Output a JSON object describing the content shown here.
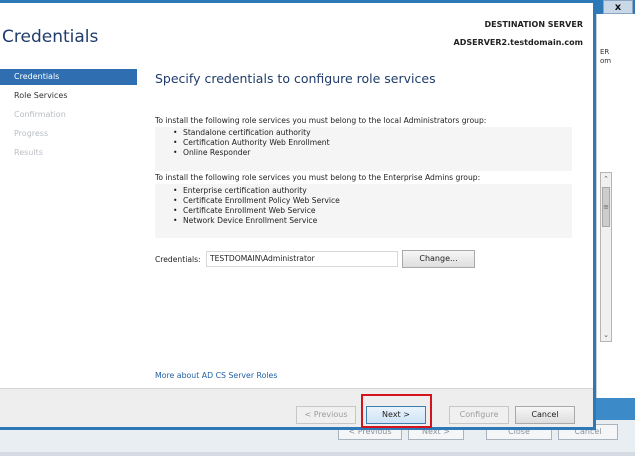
{
  "background": {
    "right_panel_text": "ER\nom",
    "close_glyph": "x",
    "ghost_buttons": [
      "< Previous",
      "Next >",
      "Close",
      "Cancel"
    ]
  },
  "wizard": {
    "title": "Credentials",
    "destination_label": "DESTINATION SERVER",
    "destination_server": "ADSERVER2.testdomain.com"
  },
  "nav": {
    "items": [
      {
        "label": "Credentials",
        "state": "active"
      },
      {
        "label": "Role Services",
        "state": "enabled"
      },
      {
        "label": "Confirmation",
        "state": "disabled"
      },
      {
        "label": "Progress",
        "state": "disabled"
      },
      {
        "label": "Results",
        "state": "disabled"
      }
    ]
  },
  "main": {
    "heading": "Specify credentials to configure role services",
    "local_admin_intro": "To install the following role services you must belong to the local Administrators group:",
    "local_admin_services": [
      "Standalone certification authority",
      "Certification Authority Web Enrollment",
      "Online Responder"
    ],
    "enterprise_admin_intro": "To install the following role services you must belong to the Enterprise Admins group:",
    "enterprise_admin_services": [
      "Enterprise certification authority",
      "Certificate Enrollment Policy Web Service",
      "Certificate Enrollment Web Service",
      "Network Device Enrollment Service"
    ],
    "credentials_label": "Credentials:",
    "credentials_value": "TESTDOMAIN\\Administrator",
    "change_button": "Change...",
    "more_link": "More about AD CS Server Roles"
  },
  "footer": {
    "previous": "< Previous",
    "next": "Next >",
    "configure": "Configure",
    "cancel": "Cancel"
  },
  "colors": {
    "accent_blue": "#2f6fb1",
    "title_navy": "#1f3c6b",
    "highlight_red": "#d4141c"
  }
}
